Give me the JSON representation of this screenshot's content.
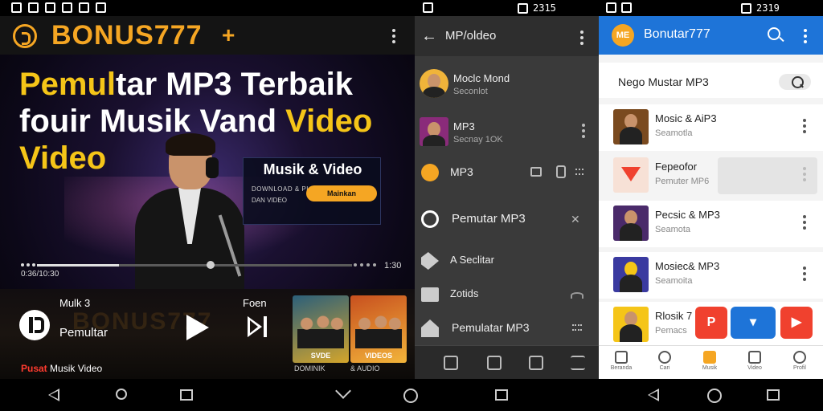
{
  "status": {
    "mid_time": "2315",
    "right_time": "2319"
  },
  "panel1": {
    "brand": "BONUS777",
    "brand_plus": "+",
    "headline": {
      "line1_white": "Pemul",
      "line1_rest": "tar MP3 Terbaik",
      "line2_white": "fouir Musik Vand ",
      "line2_yellow": "Video",
      "line3": "Video"
    },
    "promo": {
      "title": "Musik & Video",
      "sub": "DOWNLOAD & PLAY MP3",
      "sub2": "DAN VIDEO",
      "button": "Mainkan"
    },
    "progress": {
      "played_fraction": 0.55,
      "loaded_fraction": 0.26
    },
    "time_current": "0:36/10:30",
    "time_total": "1:30",
    "now_label": "Mulk 3",
    "now_title": "Pemultar",
    "next_label": "Foen",
    "footer_prefix": "Pusat",
    "footer_label": " Musik Video",
    "brand_ghost": "BONUS777",
    "posters": [
      {
        "title": "SVDE",
        "caption": "DOMINIK",
        "color_a": "#2b5f7a",
        "color_b": "#d4a52b"
      },
      {
        "title": "VIDEOS",
        "caption": "& AUDIO",
        "color_a": "#c8501f",
        "color_b": "#f2b43a"
      }
    ]
  },
  "panel2": {
    "title": "MP/oldeo",
    "rows": [
      {
        "title": "Moclc Mond",
        "sub": "Seconlot"
      },
      {
        "title": "MP3",
        "sub": "Secnay 1OK"
      }
    ],
    "menu": [
      {
        "label": "MP3",
        "icon": "mp3-icon"
      },
      {
        "label": "Pemutar MP3",
        "icon": "chat-icon"
      },
      {
        "label": "A Seclitar",
        "icon": "tag-icon"
      },
      {
        "label": "Zotids",
        "icon": "folder-icon"
      },
      {
        "label": "Pemulatar MP3",
        "icon": "home-icon"
      }
    ]
  },
  "panel3": {
    "logo": "ME",
    "title": "Bonutar777",
    "section_title": "Nego Mustar MP3",
    "items": [
      {
        "title": "Mosic & AiP3",
        "sub": "Seamotla"
      },
      {
        "title": "Fepeofor",
        "sub": "Pemuter MP6"
      },
      {
        "title": "Pecsic & MP3",
        "sub": "Seamota"
      },
      {
        "title": "Mosiec& MP3",
        "sub": "Seamoita"
      },
      {
        "title": "Rlosik 7",
        "sub": "Pemacs"
      }
    ],
    "fabs": [
      {
        "label": "P",
        "color": "#f0412e"
      },
      {
        "label": "▾",
        "color": "#1e74d8"
      },
      {
        "label": "▶",
        "color": "#f0412e"
      }
    ],
    "nav": [
      {
        "label": "Beranda",
        "icon": "home-icon"
      },
      {
        "label": "Cari",
        "icon": "search-icon"
      },
      {
        "label": "Musik",
        "icon": "music-icon"
      },
      {
        "label": "Video",
        "icon": "video-icon"
      },
      {
        "label": "Profil",
        "icon": "profile-icon"
      }
    ]
  },
  "colors": {
    "accent": "#f5a623",
    "blue": "#1e74d8",
    "red": "#f0412e"
  }
}
